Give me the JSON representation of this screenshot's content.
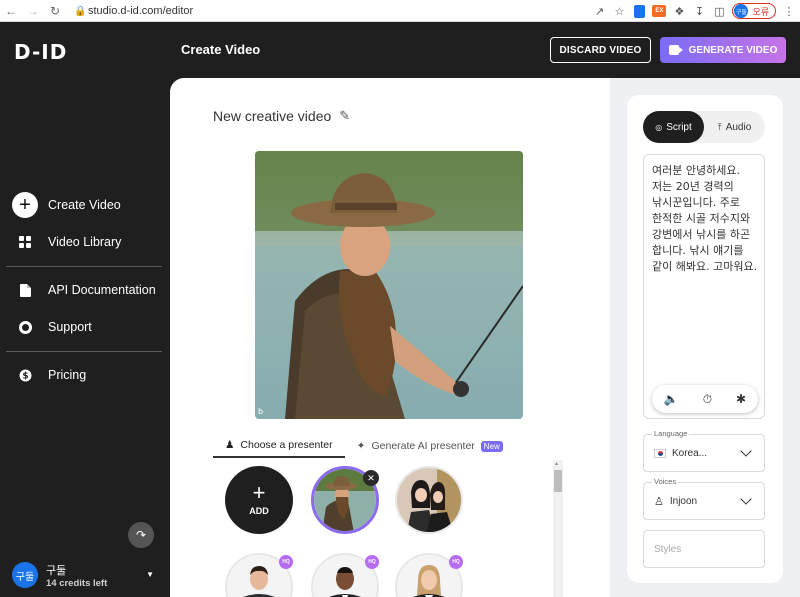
{
  "browser": {
    "url": "studio.d-id.com/editor",
    "profile_label": "오류",
    "profile_initials": "구둘"
  },
  "sidebar": {
    "logo": "D-ID",
    "items": [
      {
        "label": "Create Video",
        "icon": "plus-circle-icon"
      },
      {
        "label": "Video Library",
        "icon": "grid-icon"
      },
      {
        "label": "API Documentation",
        "icon": "document-icon"
      },
      {
        "label": "Support",
        "icon": "lifebuoy-icon"
      },
      {
        "label": "Pricing",
        "icon": "dollar-icon"
      }
    ],
    "user": {
      "initials": "구둘",
      "name": "구둘",
      "credits": "14 credits left"
    }
  },
  "header": {
    "title": "Create Video",
    "discard_label": "DISCARD VIDEO",
    "generate_label": "GENERATE VIDEO"
  },
  "main": {
    "video_title": "New creative video",
    "tabs": [
      {
        "label": "Choose a presenter",
        "active": true
      },
      {
        "label": "Generate AI presenter",
        "badge": "New"
      }
    ],
    "presenters": {
      "add_label": "ADD",
      "hq_badge": "HQ"
    }
  },
  "right_panel": {
    "tabs": [
      {
        "label": "Script",
        "active": true
      },
      {
        "label": "Audio"
      }
    ],
    "script": "여러분 안녕하세요. 저는 20년 경력의 낚시꾼입니다. 주로 한적한 시골 저수지와 강변에서 낚시를 하곤 합니다. 낚시 얘기를 같이 해봐요. 고마워요.",
    "language": {
      "label": "Language",
      "value": "Korea..."
    },
    "voices": {
      "label": "Voices",
      "value": "Injoon"
    },
    "styles": {
      "placeholder": "Styles"
    }
  },
  "colors": {
    "sidebar_bg": "#1f1f1f",
    "accent_gradient_start": "#7a6cf5",
    "accent_gradient_end": "#c673e6",
    "selected_border": "#8c6bf0"
  }
}
